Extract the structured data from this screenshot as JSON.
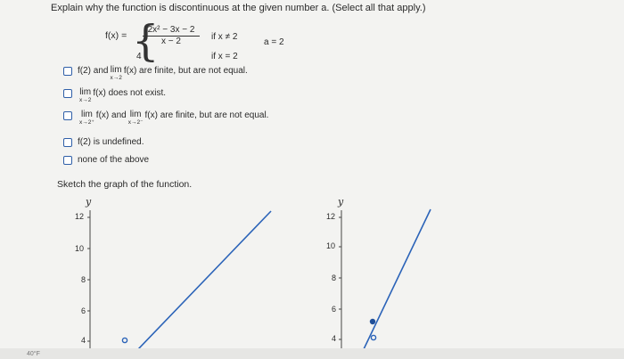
{
  "question": "Explain why the function is discontinuous at the given number a. (Select all that apply.)",
  "function": {
    "lhs": "f(x) =",
    "piece1_num": "2x² − 3x − 2",
    "piece1_den": "x − 2",
    "piece1_cond": "if x ≠ 2",
    "piece2_val": "4",
    "piece2_cond": "if x = 2",
    "a_value": "a = 2"
  },
  "options": [
    {
      "pre": "f(2) and",
      "lim_top": "lim",
      "lim_sub": "x→2",
      "post": "f(x) are finite, but are not equal."
    },
    {
      "pre": "",
      "lim_top": "lim",
      "lim_sub": "x→2",
      "post": "f(x) does not exist."
    },
    {
      "pre": "",
      "lim_top": "lim",
      "lim_sub": "x→2⁺",
      "mid": "f(x) and",
      "lim2_top": "lim",
      "lim2_sub": "x→2⁻",
      "post": "f(x) are finite, but are not equal."
    },
    {
      "text": "f(2) is undefined."
    },
    {
      "text": "none of the above"
    }
  ],
  "sketch_label": "Sketch the graph of the function.",
  "graph_left": {
    "axis_label": "y",
    "ticks": [
      "12",
      "10",
      "8",
      "6",
      "4"
    ]
  },
  "graph_right": {
    "axis_label": "y",
    "ticks": [
      "12",
      "10",
      "8",
      "6",
      "4"
    ]
  },
  "taskbar_temp": "40°F",
  "colors": {
    "checkbox": "#2f5fa8",
    "line": "#2b63b8",
    "point": "#1f4f99"
  }
}
